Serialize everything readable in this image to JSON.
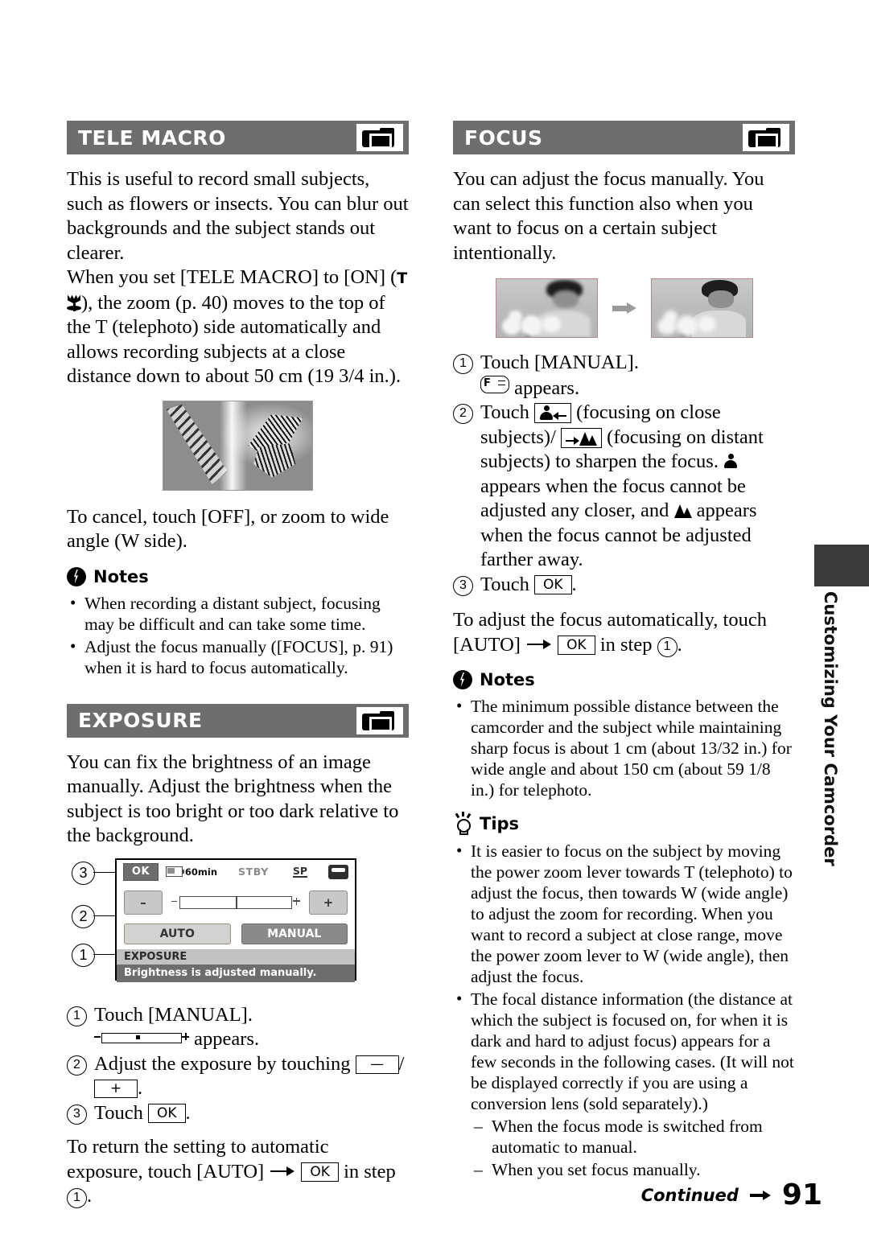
{
  "page": {
    "number": "91",
    "continued_label": "Continued",
    "side_tab_text": "Customizing Your Camcorder"
  },
  "left_column": {
    "tele_macro": {
      "heading": "TELE MACRO",
      "icon": "camcorder-icon",
      "paragraph1": "This is useful to record small subjects, such as flowers or insects. You can blur out backgrounds and the subject stands out clearer.",
      "paragraph2_a": "When you set [TELE MACRO] to [ON] (",
      "paragraph2_t": "T",
      "paragraph2_b": "), the zoom (p. 40) moves to the top of the T (telephoto) side automatically and allows recording subjects at a close distance down to about 50 cm (19 3/4 in.).",
      "image_caption": "butterfly-photo",
      "cancel_text": "To cancel, touch [OFF], or zoom to wide angle (W side).",
      "notes_heading": "Notes",
      "notes": [
        "When recording a distant subject, focusing may be difficult and can take some time.",
        "Adjust the focus manually ([FOCUS], p. 91) when it is hard to focus automatically."
      ]
    },
    "exposure": {
      "heading": "EXPOSURE",
      "icon": "camcorder-icon",
      "paragraph1": "You can fix the brightness of an image manually. Adjust the brightness when the subject is too bright or too dark relative to the background.",
      "lcd": {
        "ok_label": "OK",
        "battery_label": "60min",
        "status_label": "STBY",
        "quality_label": "SP",
        "tape_icon": "cassette-icon",
        "minus_label": "–",
        "plus_label": "+",
        "auto_label": "AUTO",
        "manual_label": "MANUAL",
        "menu_label": "EXPOSURE",
        "status_message": "Brightness is adjusted manually.",
        "callouts": [
          "3",
          "2",
          "1"
        ]
      },
      "steps": [
        {
          "num": "1",
          "text_before": "Touch [MANUAL].",
          "text_after": ""
        },
        {
          "num": "2",
          "text_before": "Adjust the exposure by touching ",
          "text_after": "."
        },
        {
          "num": "3",
          "text_before": "Touch ",
          "text_after": "."
        }
      ],
      "slider_appears_text": "appears.",
      "step3_ok": "OK",
      "return_text_a": "To return the setting to automatic exposure, touch [AUTO]",
      "return_ok": "OK",
      "return_text_b": "in step",
      "return_step": "1"
    }
  },
  "right_column": {
    "focus": {
      "heading": "FOCUS",
      "icon": "camcorder-icon",
      "paragraph1": "You can adjust the focus manually. You can select this function also when you want to focus on a certain subject intentionally.",
      "image_caption": "focus-before-after-photos",
      "step1_num": "1",
      "step1_text": "Touch [MANUAL].",
      "step1_sub_after": "appears.",
      "step2_num": "2",
      "step2_a": "Touch ",
      "step2_b": " (focusing on close subjects)/",
      "step2_c": " (focusing on distant subjects) to sharpen the focus. ",
      "step2_d": " appears when the focus cannot be adjusted any closer, and ",
      "step2_e": " appears when the focus cannot be adjusted farther away.",
      "step3_num": "3",
      "step3_a": "Touch ",
      "step3_ok": "OK",
      "step3_b": ".",
      "auto_text_a": "To adjust the focus automatically, touch [AUTO]",
      "auto_ok": "OK",
      "auto_text_b": "in step",
      "auto_step": "1",
      "notes_heading": "Notes",
      "notes": [
        "The minimum possible distance between the camcorder and the subject while maintaining sharp focus is about 1 cm (about 13/32 in.) for wide angle and about 150 cm (about 59 1/8 in.) for telephoto."
      ],
      "tips_heading": "Tips",
      "tips": [
        "It is easier to focus on the subject by moving the power zoom lever towards T (telephoto) to adjust the focus, then towards W (wide angle) to adjust the zoom for recording. When you want to record a subject at close range, move the power zoom lever to W (wide angle), then adjust the focus.",
        "The focal distance information (the distance at which the subject is focused on, for when it is dark and hard to adjust focus) appears for a few seconds in the following cases. (It will not be displayed correctly if you are using a conversion lens (sold separately).)"
      ],
      "tip_sub_items": [
        "When the focus mode is switched from automatic to manual.",
        "When you set focus manually."
      ]
    }
  },
  "colors": {
    "header_bar": "#6e6e6e",
    "lcd_status_bar": "#6d6d6d",
    "lcd_menu_bar": "#c2c2c2",
    "manual_button": "#8a8a8a",
    "auto_button": "#d2d2d2",
    "side_tab": "#3a3a3a"
  }
}
